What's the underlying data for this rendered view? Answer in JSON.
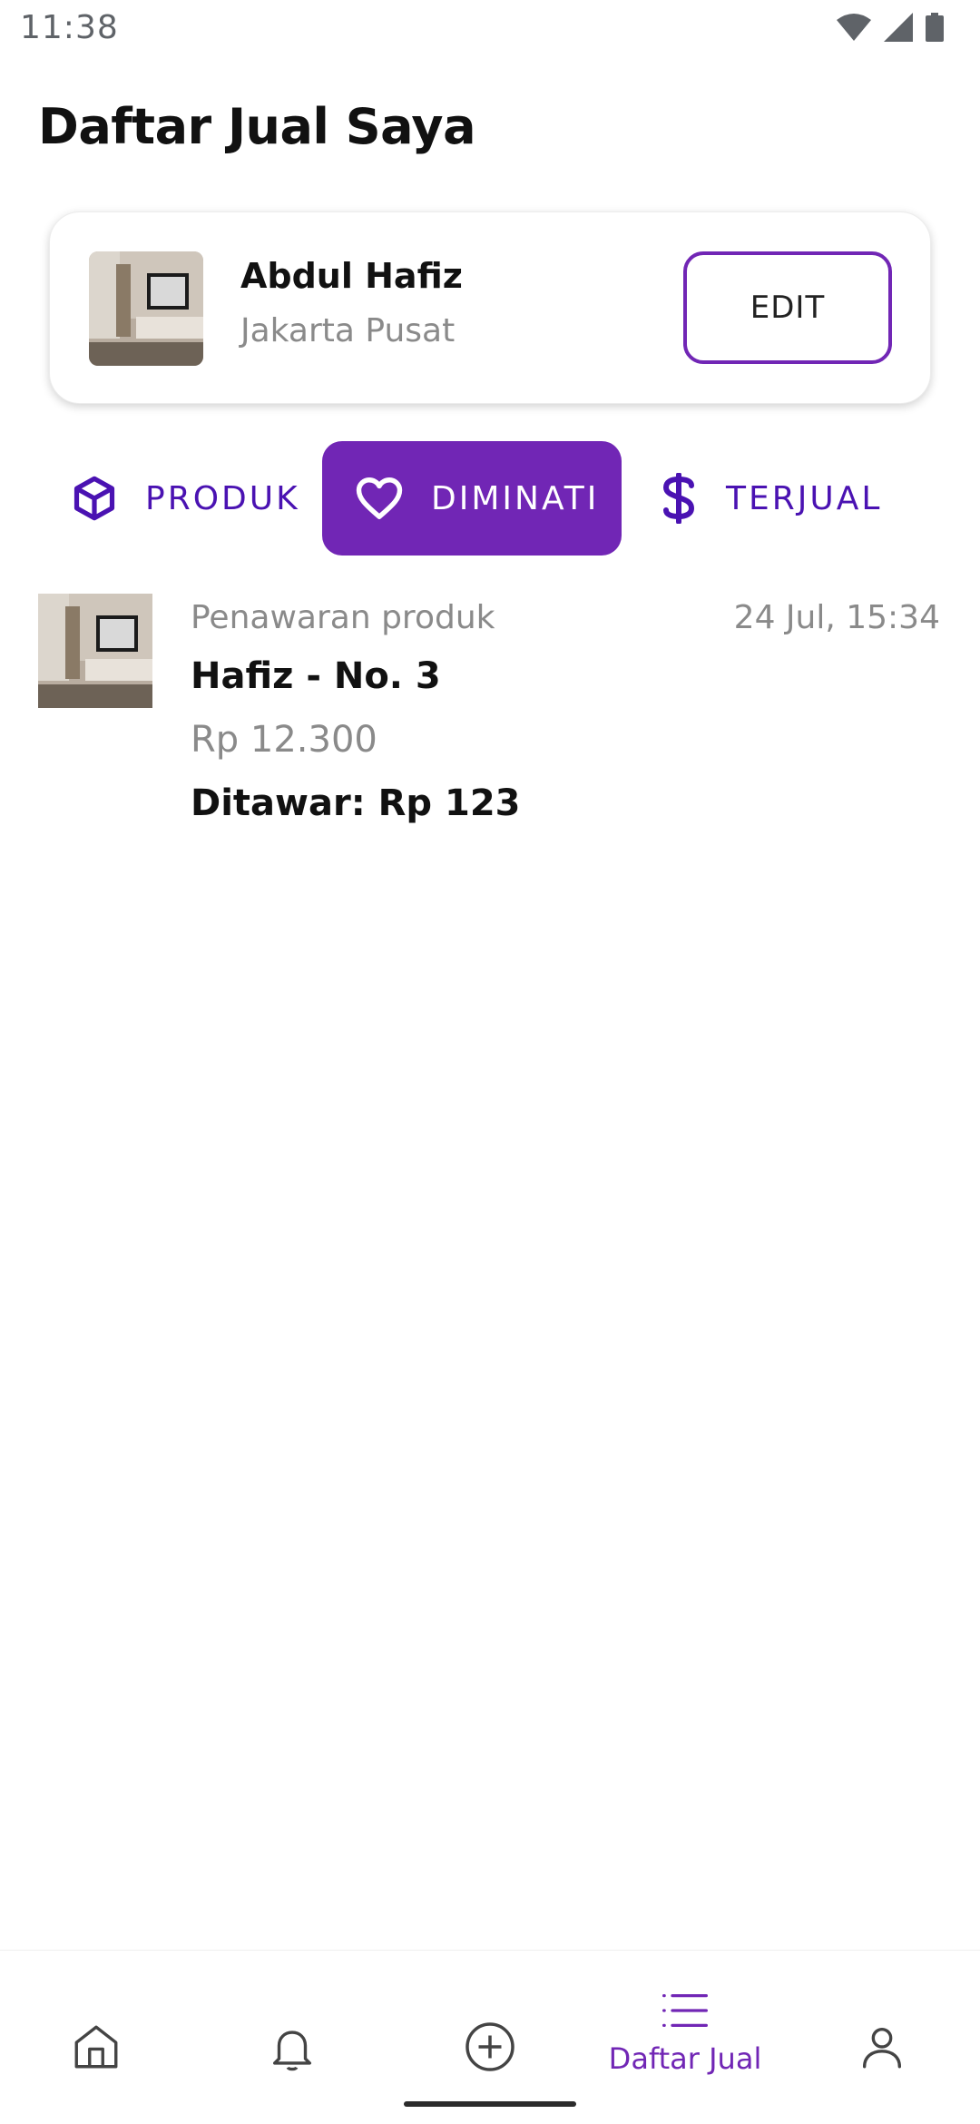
{
  "status_bar": {
    "time": "11:38",
    "icons": [
      "wifi-icon",
      "cell-signal-icon",
      "battery-icon"
    ]
  },
  "page": {
    "title": "Daftar Jual Saya"
  },
  "seller": {
    "name": "Abdul Hafiz",
    "city": "Jakarta Pusat",
    "edit_label": "EDIT"
  },
  "tabs": [
    {
      "label": "PRODUK",
      "icon": "box-icon",
      "active": false
    },
    {
      "label": "DIMINATI",
      "icon": "heart-icon",
      "active": true
    },
    {
      "label": "TERJUAL",
      "icon": "dollar-icon",
      "active": false
    }
  ],
  "offers": [
    {
      "type": "Penawaran produk",
      "time": "24 Jul, 15:34",
      "product": "Hafiz - No. 3",
      "price": "Rp 12.300",
      "bid": "Ditawar: Rp 123"
    }
  ],
  "bottom_nav": {
    "items": [
      {
        "icon": "home-icon",
        "label": ""
      },
      {
        "icon": "bell-icon",
        "label": ""
      },
      {
        "icon": "plus-circle-icon",
        "label": ""
      },
      {
        "icon": "list-icon",
        "label": "Daftar Jual",
        "active": true
      },
      {
        "icon": "user-icon",
        "label": ""
      }
    ]
  },
  "colors": {
    "accent": "#7126b5",
    "tab_text": "#4a12b2",
    "muted_text": "#8a8a8a"
  }
}
